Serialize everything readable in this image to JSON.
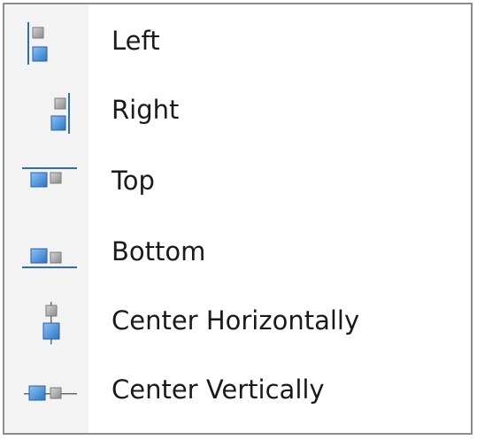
{
  "menu": {
    "items": [
      {
        "label": "Left",
        "icon": "align-left-icon"
      },
      {
        "label": "Right",
        "icon": "align-right-icon"
      },
      {
        "label": "Top",
        "icon": "align-top-icon"
      },
      {
        "label": "Bottom",
        "icon": "align-bottom-icon"
      },
      {
        "label": "Center Horizontally",
        "icon": "align-center-horizontally-icon"
      },
      {
        "label": "Center Vertically",
        "icon": "align-center-vertically-icon"
      }
    ]
  },
  "colors": {
    "border": "#8c8c8c",
    "gutter": "#f3f3f3",
    "icon_blue": "#3d86d4",
    "icon_gray": "#9a9a9a",
    "guide_line": "#2f6fb5"
  }
}
